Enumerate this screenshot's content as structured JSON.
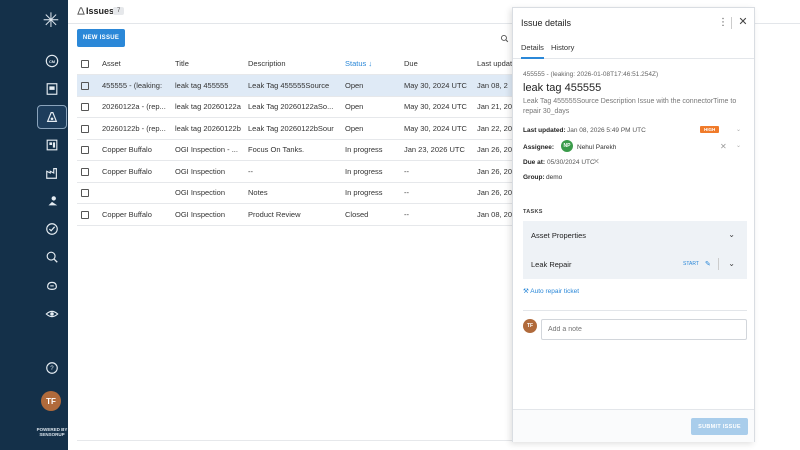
{
  "app": {
    "powered_by": "POWERED BY SENSORUP"
  },
  "sidebar": {
    "user_initials": "TF",
    "items": [
      {
        "icon": "cm-icon"
      },
      {
        "icon": "map-book-icon"
      },
      {
        "icon": "issues-icon",
        "active": true
      },
      {
        "icon": "dashboard-icon"
      },
      {
        "icon": "factory-icon"
      },
      {
        "icon": "people-icon"
      },
      {
        "icon": "check-circle-icon"
      },
      {
        "icon": "search-zoom-icon"
      },
      {
        "icon": "gas-icon"
      },
      {
        "icon": "eye-icon"
      },
      {
        "icon": "help-icon"
      }
    ]
  },
  "header": {
    "title": "Issues",
    "count": "7"
  },
  "toolbar": {
    "new_label": "NEW ISSUE"
  },
  "table": {
    "columns": [
      "Asset",
      "Title",
      "Description",
      "Status",
      "Due",
      "Last updat"
    ],
    "sorted_column": "Status",
    "rows": [
      {
        "asset": "455555 - (leaking:",
        "title": "leak tag 455555",
        "description": "Leak Tag 455555Source",
        "status": "Open",
        "due": "May 30, 2024 UTC",
        "updated": "Jan 08, 2",
        "selected": true
      },
      {
        "asset": "20260122a - (rep...",
        "title": "leak tag 20260122a",
        "description": "Leak Tag 20260122aSo...",
        "status": "Open",
        "due": "May 30, 2024 UTC",
        "updated": "Jan 21, 20"
      },
      {
        "asset": "20260122b - (rep...",
        "title": "leak tag 20260122b",
        "description": "Leak Tag 20260122bSour",
        "status": "Open",
        "due": "May 30, 2024 UTC",
        "updated": "Jan 22, 20"
      },
      {
        "asset": "Copper Buffalo",
        "title": "OGI Inspection - ...",
        "description": "Focus On Tanks.",
        "status": "In progress",
        "due": "Jan 23, 2026 UTC",
        "updated": "Jan 26, 20"
      },
      {
        "asset": "Copper Buffalo",
        "title": "OGI Inspection",
        "description": "--",
        "status": "In progress",
        "due": "--",
        "updated": "Jan 26, 20"
      },
      {
        "asset": "",
        "title": "OGI Inspection",
        "description": "Notes",
        "status": "In progress",
        "due": "--",
        "updated": "Jan 26, 20"
      },
      {
        "asset": "Copper Buffalo",
        "title": "OGI Inspection",
        "description": "Product Review",
        "status": "Closed",
        "due": "--",
        "updated": "Jan 08, 20"
      }
    ]
  },
  "panel": {
    "title": "Issue details",
    "tabs": [
      "Details",
      "History"
    ],
    "subtitle": "455555 - (leaking: 2026-01-08T17:46:51.254Z)",
    "name": "leak tag 455555",
    "description": "Leak Tag 455555Source Description Issue with the connectorTime to repair 30_days",
    "last_updated_label": "Last updated:",
    "last_updated": "Jan 08, 2026 5:49 PM UTC",
    "priority": "HIGH",
    "priority_color": "#f07b2a",
    "assignee_label": "Assignee:",
    "assignee_initials": "NP",
    "assignee": "Nehul Parekh",
    "due_label": "Due at:",
    "due": "05/30/2024 UTC",
    "group_label": "Group:",
    "group": "demo",
    "tasks_label": "TASKS",
    "tasks": [
      {
        "label": "Asset Properties"
      },
      {
        "label": "Leak Repair",
        "start": "START"
      }
    ],
    "auto_repair": "Auto repair ticket",
    "note_placeholder": "Add a note",
    "note_initials": "TF",
    "submit_label": "SUBMIT ISSUE"
  },
  "colors": {
    "accent": "#2b88d8",
    "sidebar": "#143049",
    "selected_row": "#dfeaf6"
  }
}
